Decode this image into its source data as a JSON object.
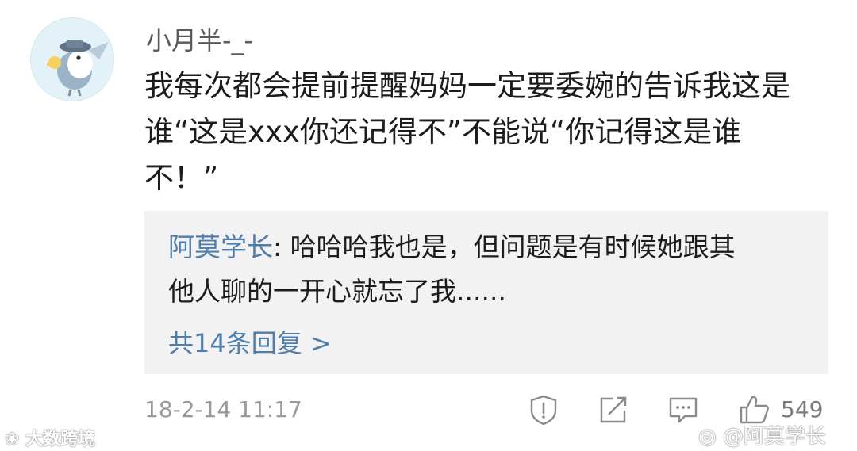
{
  "comment": {
    "username": "小月半-_-",
    "lines": [
      "我每次都会提前提醒妈妈一定要委婉的告诉我这是",
      "谁“这是xxx你还记得不”不能说“你记得这是谁",
      "不！”"
    ]
  },
  "reply": {
    "user": "阿莫学长",
    "separator": ": ",
    "text_line1": "哈哈哈我也是，但问题是有时候她跟其",
    "text_line2": "他人聊的一开心就忘了我......",
    "more_link": "共14条回复 >"
  },
  "footer": {
    "timestamp": "18-2-14 11:17",
    "likes": "549",
    "icons": [
      "report-icon",
      "share-icon",
      "comment-icon",
      "like-icon"
    ]
  },
  "watermarks": {
    "left": "大数跨境",
    "right": "@阿莫学长"
  },
  "colors": {
    "link": "#4f7dac",
    "reply_bg": "#f2f2f2",
    "avatar_bg": "#e3f1f9",
    "meta": "#9a9a9a"
  }
}
